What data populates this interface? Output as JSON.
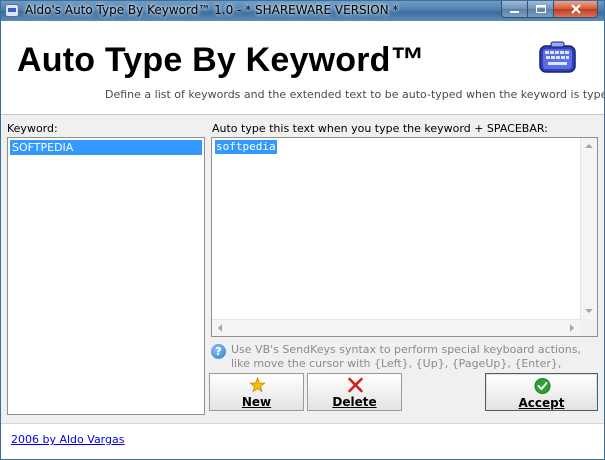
{
  "window": {
    "title": "Aldo's Auto Type By Keyword™ 1.0 - * SHAREWARE VERSION *"
  },
  "header": {
    "title": "Auto Type By Keyword™",
    "subtitle": "Define a list of keywords and the extended text to be auto-typed when the keyword is typed",
    "icon": "keyboard-icon"
  },
  "keywords": {
    "label": "Keyword:",
    "items": [
      "SOFTPEDIA"
    ],
    "selected_index": 0
  },
  "autotype": {
    "label": "Auto type this text when you type the keyword + SPACEBAR:",
    "value": "softpedia"
  },
  "hint": {
    "icon": "help-icon",
    "text": "Use VB's SendKeys syntax to perform special keyboard actions, like move the cursor with {Left}, {Up}, {PageUp}, {Enter}, {Del}, etc."
  },
  "buttons": {
    "new_label": "New",
    "delete_label": "Delete",
    "accept_label": "Accept"
  },
  "footer": {
    "link_text": "2006 by Aldo Vargas"
  },
  "colors": {
    "selection": "#3399ff",
    "link": "#0000ee",
    "delete_x": "#d2201a",
    "accept_check": "#2aa334",
    "new_star": "#f5c400"
  }
}
